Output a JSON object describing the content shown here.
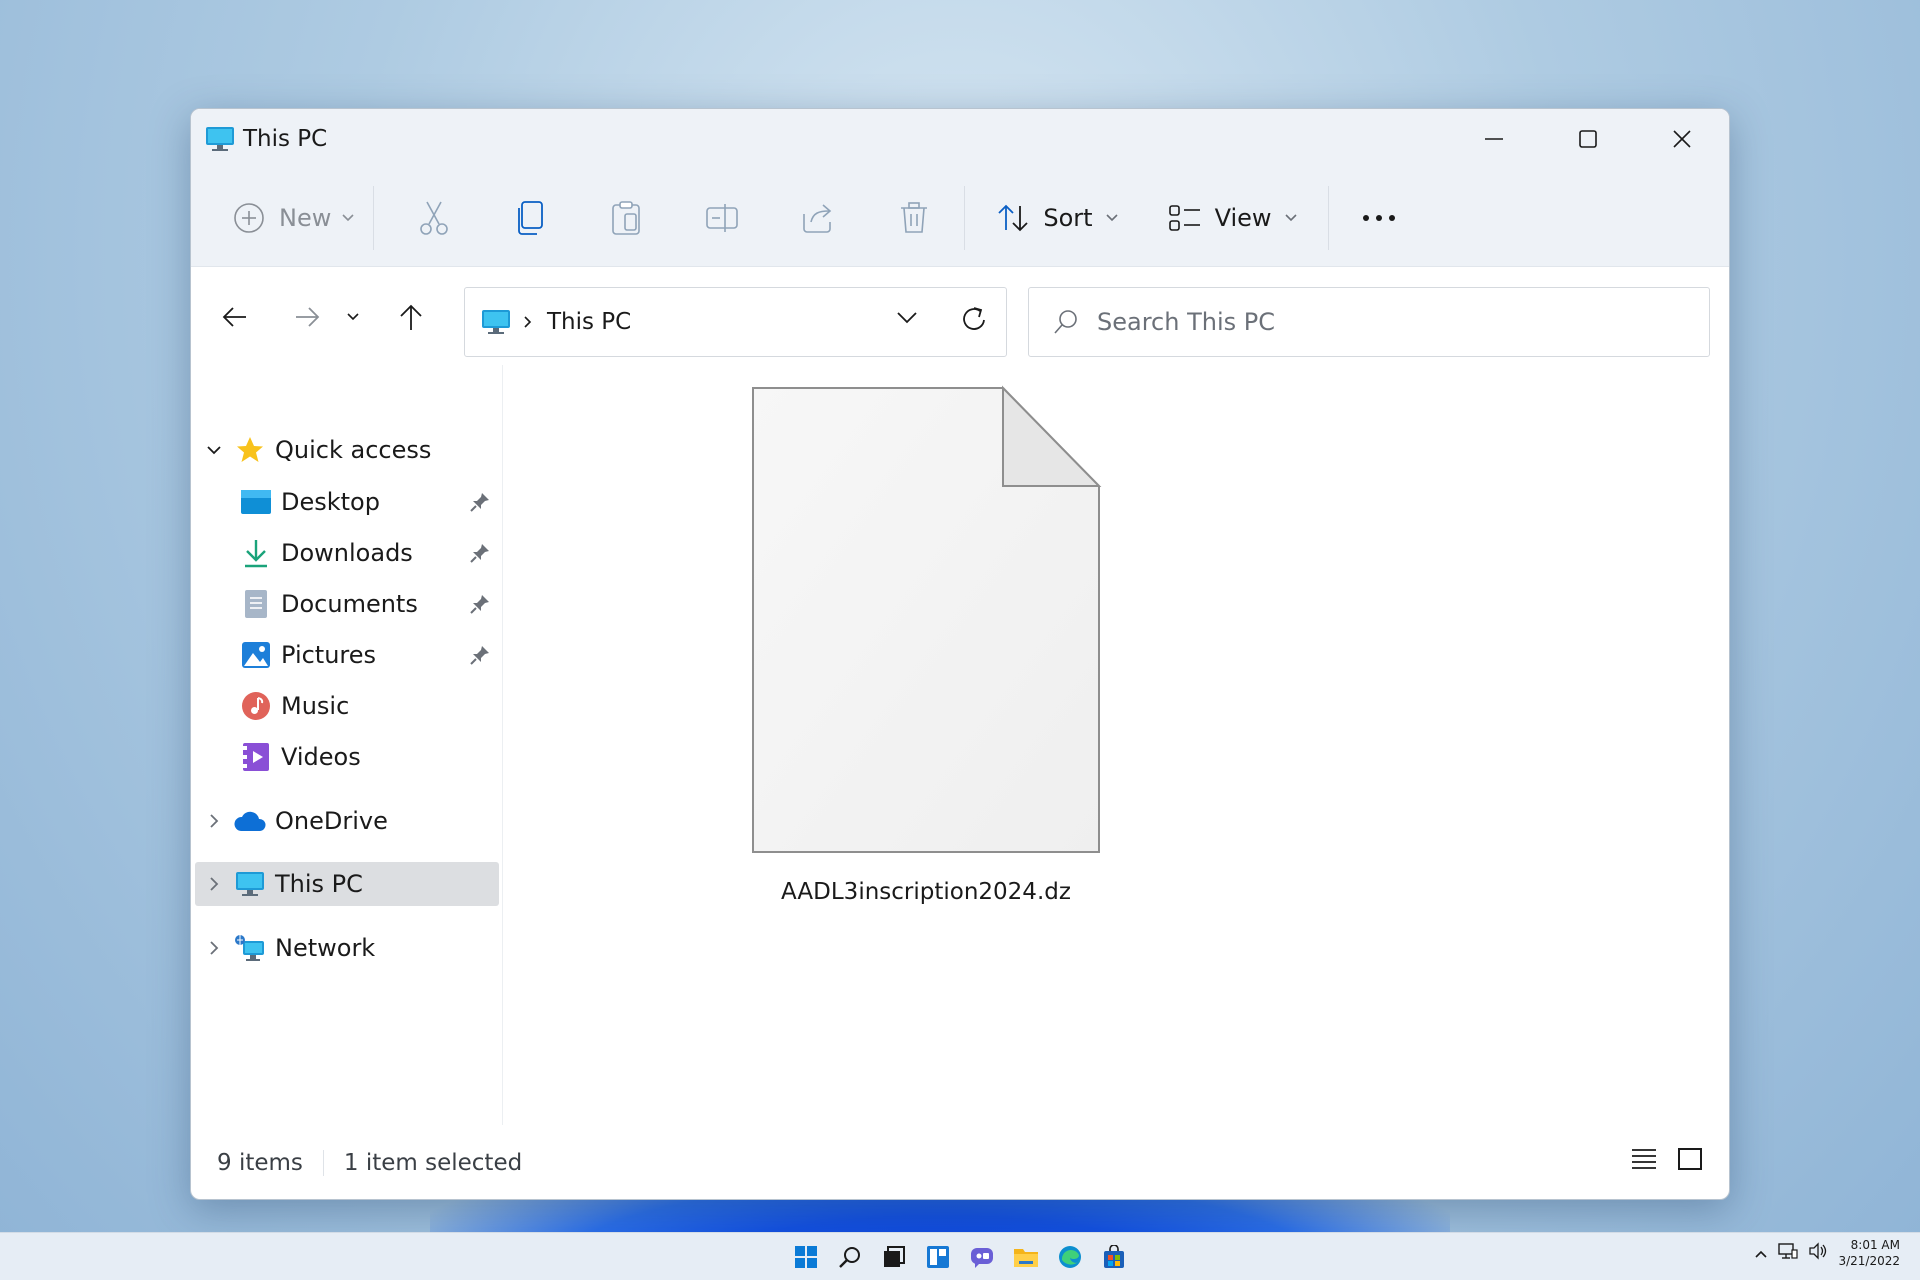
{
  "window": {
    "title": "This PC",
    "controls": [
      "minimize-icon",
      "maximize-icon",
      "close-icon"
    ]
  },
  "toolbar": {
    "new_label": "New",
    "sort_label": "Sort",
    "view_label": "View",
    "icons": [
      "plus-circle-icon",
      "cut-icon",
      "copy-icon",
      "paste-icon",
      "rename-icon",
      "share-icon",
      "delete-icon",
      "sort-icon",
      "view-icon",
      "more-icon"
    ]
  },
  "address": {
    "path": "This PC",
    "search_placeholder": "Search This PC"
  },
  "sidebar": {
    "quick_access": "Quick access",
    "items": [
      {
        "label": "Desktop",
        "pinned": true
      },
      {
        "label": "Downloads",
        "pinned": true
      },
      {
        "label": "Documents",
        "pinned": true
      },
      {
        "label": "Pictures",
        "pinned": true
      },
      {
        "label": "Music",
        "pinned": false
      },
      {
        "label": "Videos",
        "pinned": false
      }
    ],
    "onedrive": "OneDrive",
    "this_pc": "This PC",
    "network": "Network"
  },
  "content": {
    "file_name": "AADL3inscription2024.dz"
  },
  "status": {
    "item_count": "9 items",
    "selected": "1 item selected"
  },
  "taskbar": {
    "time": "8:01 AM",
    "date": "3/21/2022"
  },
  "colors": {
    "accent": "#0a5fc4",
    "selection": "#dcdee1"
  }
}
